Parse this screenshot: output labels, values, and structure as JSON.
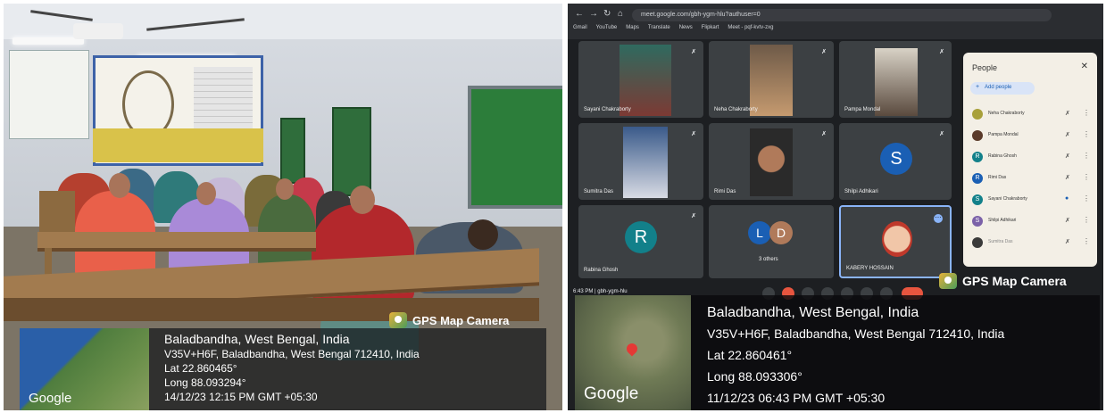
{
  "left_photo": {
    "gps_tag": "GPS Map Camera",
    "location": "Baladbandha, West Bengal, India",
    "address": "V35V+H6F, Baladbandha, West Bengal 712410, India",
    "lat": "Lat 22.860465°",
    "long": "Long 88.093294°",
    "datetime": "14/12/23 12:15 PM GMT +05:30",
    "map_label": "Google"
  },
  "right_photo": {
    "browser": {
      "url": "meet.google.com/gbh-ygm-hlu?authuser=0",
      "bookmarks": [
        "Gmail",
        "YouTube",
        "Maps",
        "Translate",
        "News",
        "Flipkart",
        "Meet - pqf-kvtv-zxg"
      ]
    },
    "tiles": [
      {
        "name": "Sayani Chakraborty"
      },
      {
        "name": "Neha Chakraborty"
      },
      {
        "name": "Pampa Mondal"
      },
      {
        "name": "Sumitra Das"
      },
      {
        "name": "Rimi Das"
      },
      {
        "name": "Shilpi Adhikari",
        "initial": "S"
      },
      {
        "name": "Rabina Ghosh",
        "initial": "R"
      },
      {
        "name": "3 others",
        "initials": [
          "L",
          "D"
        ]
      },
      {
        "name": "KABERY HOSSAIN"
      }
    ],
    "people_panel": {
      "title": "People",
      "add_people": "Add people",
      "members": [
        {
          "name": "Neha Chakraborty"
        },
        {
          "name": "Pampa Mondal"
        },
        {
          "name": "Rabina Ghosh",
          "initial": "R"
        },
        {
          "name": "Rimi Das",
          "initial": "R"
        },
        {
          "name": "Sayani Chakraborty",
          "initial": "S"
        },
        {
          "name": "Shilpi Adhikari",
          "initial": "S"
        },
        {
          "name": "Sumitra Das"
        }
      ]
    },
    "meeting_footer": "6:43 PM  |  gbh-ygm-hlu",
    "gps_tag": "GPS Map Camera",
    "location": "Baladbandha, West Bengal, India",
    "address": "V35V+H6F, Baladbandha, West Bengal 712410, India",
    "lat": "Lat 22.860461°",
    "long": "Long 88.093306°",
    "datetime": "11/12/23 06:43 PM GMT +05:30",
    "map_label": "Google"
  },
  "colors": {
    "avatar_blue": "#1a5fb4",
    "avatar_teal": "#12808a",
    "avatar_purple": "#7b61a8",
    "avatar_brown": "#b07a5a",
    "end_call_red": "#e8553f"
  }
}
